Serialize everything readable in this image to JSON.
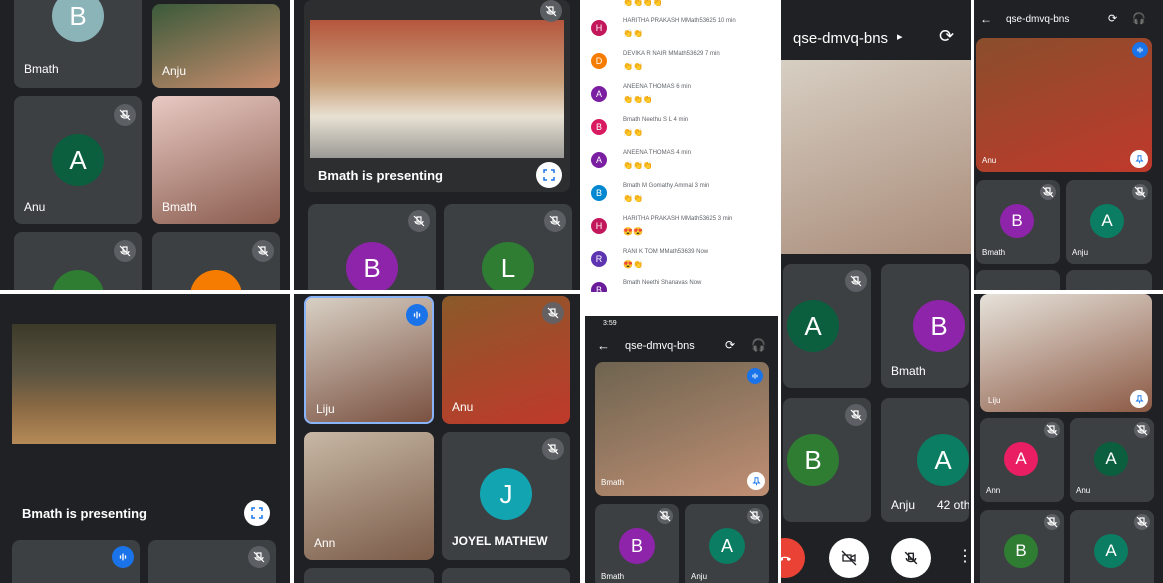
{
  "colors": {
    "meet_dark": "#202124",
    "tile": "#3c4043",
    "speaking_blue": "#1a73e8",
    "hangup_red": "#ea4335"
  },
  "p1": {
    "tiles": [
      {
        "initial": "B",
        "name": "Bmath",
        "color": "#8ab4b8"
      },
      {
        "name": "Anju"
      },
      {
        "initial": "A",
        "name": "Anu",
        "color": "#0b5f3f"
      },
      {
        "name": "Bmath"
      }
    ]
  },
  "p2": {
    "presenting": "Bmath is presenting",
    "avatars": [
      {
        "initial": "B",
        "color": "#8e24aa"
      },
      {
        "initial": "L",
        "color": "#2e7d32"
      }
    ]
  },
  "p3": {
    "presenting": "Bmath is presenting"
  },
  "p4": {
    "tiles": [
      {
        "name": "Liju"
      },
      {
        "name": "Anu"
      },
      {
        "name": "Ann"
      },
      {
        "initial": "J",
        "name": "JOYEL MATHEW",
        "color": "#12a4b0"
      }
    ]
  },
  "chat": {
    "messages": [
      {
        "initial": "H",
        "color": "#c2185b",
        "sender": "HARITHA PRAKASH MMath53625  10 min",
        "text": "👏👏"
      },
      {
        "initial": "D",
        "color": "#f57c00",
        "sender": "DEVIKA R NAIR MMath53629  7 min",
        "text": "👏👏"
      },
      {
        "initial": "A",
        "color": "#7b1fa2",
        "sender": "ANEENA THOMAS  6 min",
        "text": "👏👏👏"
      },
      {
        "initial": "B",
        "color": "#d81b60",
        "sender": "Bmath Neethu S L  4 min",
        "text": "👏👏"
      },
      {
        "initial": "A",
        "color": "#7b1fa2",
        "sender": "ANEENA THOMAS  4 min",
        "text": "👏👏👏"
      },
      {
        "initial": "B",
        "color": "#0288d1",
        "sender": "Bmath M Gomathy Ammal  3 min",
        "text": "👏👏"
      },
      {
        "initial": "H",
        "color": "#c2185b",
        "sender": "HARITHA PRAKASH MMath53625  3 min",
        "text": "😍😍"
      },
      {
        "initial": "R",
        "color": "#5e35b1",
        "sender": "RANI K TOM MMath53639  Now",
        "text": "😍👏"
      },
      {
        "initial": "B",
        "color": "#6a1b9a",
        "sender": "Bmath Neethi Shanavas  Now",
        "text": ""
      }
    ]
  },
  "p6": {
    "status_time": "3:59",
    "meeting_code": "qse-dmvq-bns",
    "main_name": "Bmath",
    "tiles": [
      {
        "initial": "B",
        "name": "Bmath",
        "color": "#8e24aa"
      },
      {
        "initial": "A",
        "name": "Anju",
        "color": "#0b7d62"
      }
    ]
  },
  "p7": {
    "meeting_code": "qse-dmvq-bns",
    "tiles": [
      {
        "initial": "A",
        "name": "",
        "color": "#0b5f3f"
      },
      {
        "initial": "B",
        "name": "Bmath",
        "color": "#8e24aa"
      },
      {
        "initial": "B",
        "name": "",
        "color": "#2e7d32"
      },
      {
        "initial": "A",
        "name": "Anju",
        "color": "#0b7d62"
      }
    ],
    "others_label": "42 oth"
  },
  "p8": {
    "meeting_code": "qse-dmvq-bns",
    "main_name": "Anu",
    "tiles": [
      {
        "initial": "B",
        "name": "Bmath",
        "color": "#8e24aa"
      },
      {
        "initial": "A",
        "name": "Anju",
        "color": "#0b7d62"
      }
    ]
  },
  "p9": {
    "main_name": "Liju",
    "tiles": [
      {
        "initial": "A",
        "name": "Ann",
        "color": "#e91e63"
      },
      {
        "initial": "A",
        "name": "Anu",
        "color": "#0b5f3f"
      },
      {
        "initial": "B",
        "name": "",
        "color": "#2e7d32"
      },
      {
        "initial": "A",
        "name": "",
        "color": "#0b7d62"
      }
    ]
  }
}
